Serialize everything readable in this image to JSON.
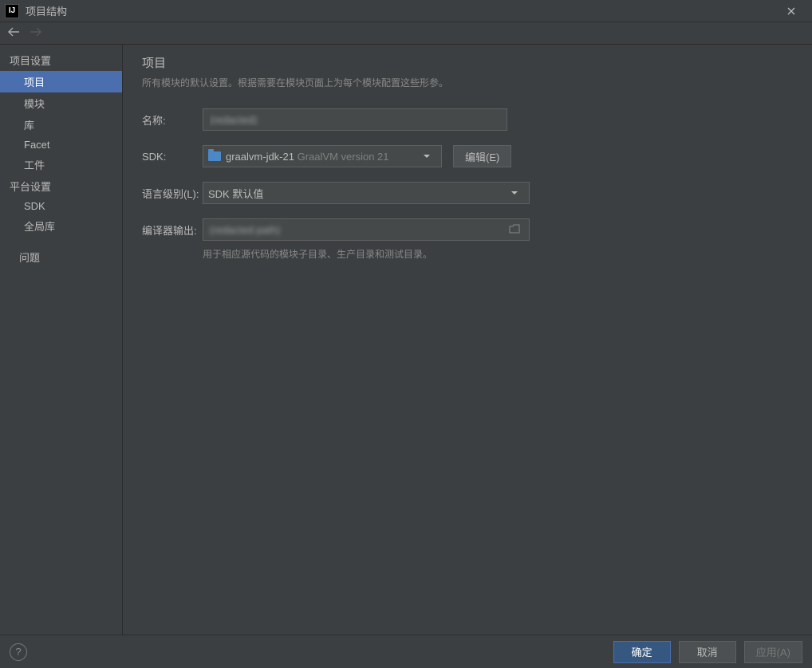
{
  "window": {
    "title": "项目结构"
  },
  "sidebar": {
    "section_project_settings": "项目设置",
    "items_project": [
      {
        "label": "项目",
        "selected": true
      },
      {
        "label": "模块",
        "selected": false
      },
      {
        "label": "库",
        "selected": false
      },
      {
        "label": "Facet",
        "selected": false
      },
      {
        "label": "工件",
        "selected": false
      }
    ],
    "section_platform_settings": "平台设置",
    "items_platform": [
      {
        "label": "SDK",
        "selected": false
      },
      {
        "label": "全局库",
        "selected": false
      }
    ],
    "item_problems": {
      "label": "问题",
      "selected": false
    }
  },
  "main": {
    "title": "项目",
    "description": "所有模块的默认设置。根据需要在模块页面上为每个模块配置这些形参。",
    "labels": {
      "name": "名称:",
      "sdk": "SDK:",
      "lang_level": "语言级别(L):",
      "compiler_output": "编译器输出:"
    },
    "fields": {
      "name_value": "(redacted)",
      "sdk_value": "graalvm-jdk-21",
      "sdk_hint": "GraalVM version 21",
      "edit_button": "编辑(E)",
      "lang_level_value": "SDK 默认值",
      "compiler_output_value": "(redacted path)",
      "compiler_output_desc": "用于相应源代码的模块子目录、生产目录和测试目录。"
    }
  },
  "footer": {
    "ok": "确定",
    "cancel": "取消",
    "apply": "应用(A)"
  }
}
